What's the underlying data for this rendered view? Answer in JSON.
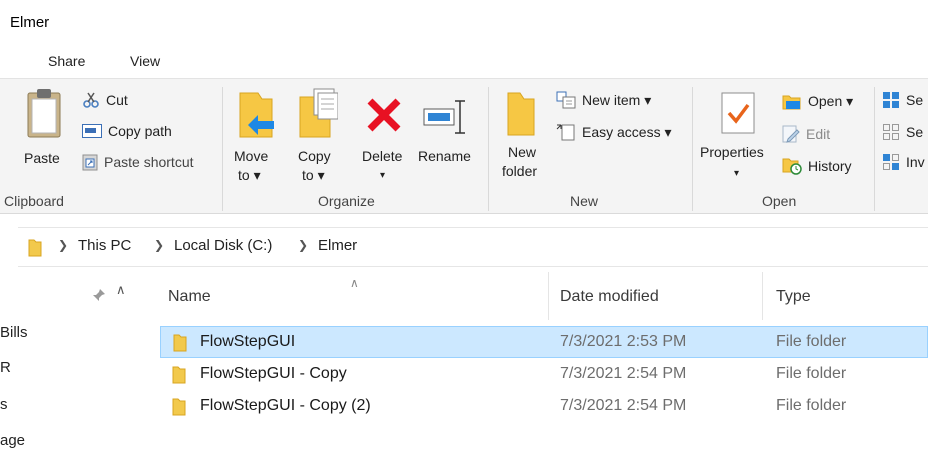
{
  "window": {
    "title": "Elmer"
  },
  "tabs": [
    "Share",
    "View"
  ],
  "ribbon": {
    "clipboard": {
      "paste": "Paste",
      "cut": "Cut",
      "copy_path": "Copy path",
      "paste_shortcut": "Paste shortcut",
      "label": "Clipboard"
    },
    "organize": {
      "move_to_line1": "Move",
      "move_to_line2": "to ▾",
      "copy_to_line1": "Copy",
      "copy_to_line2": "to ▾",
      "delete": "Delete",
      "delete_arrow": "▾",
      "rename": "Rename",
      "label": "Organize"
    },
    "new": {
      "new_folder_line1": "New",
      "new_folder_line2": "folder",
      "new_item": "New item ▾",
      "easy_access": "Easy access ▾",
      "label": "New"
    },
    "open": {
      "properties": "Properties",
      "properties_arrow": "▾",
      "open": "Open ▾",
      "edit": "Edit",
      "history": "History",
      "label": "Open"
    },
    "select": {
      "item1": "Se",
      "item2": "Se",
      "item3": "Inv"
    }
  },
  "address": {
    "crumbs": [
      "This PC",
      "Local Disk (C:)",
      "Elmer"
    ]
  },
  "nav_pane": {
    "items": [
      "Bills",
      "R",
      "s",
      "age"
    ]
  },
  "columns": {
    "name": "Name",
    "date_modified": "Date modified",
    "type": "Type"
  },
  "files": [
    {
      "name": "FlowStepGUI",
      "date": "7/3/2021 2:53 PM",
      "type": "File folder",
      "selected": true
    },
    {
      "name": "FlowStepGUI - Copy",
      "date": "7/3/2021 2:54 PM",
      "type": "File folder",
      "selected": false
    },
    {
      "name": "FlowStepGUI - Copy (2)",
      "date": "7/3/2021 2:54 PM",
      "type": "File folder",
      "selected": false
    }
  ],
  "colors": {
    "selection_bg": "#cce8ff",
    "selection_border": "#99d1ff",
    "folder": "#f2c94c",
    "delete_red": "#e81123",
    "accent_blue": "#1e88e5"
  }
}
